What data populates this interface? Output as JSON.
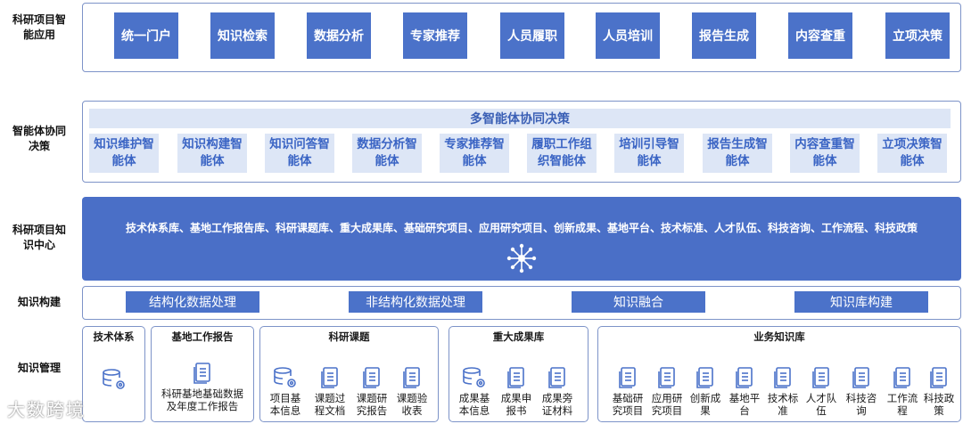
{
  "row_labels": {
    "apps": [
      "科研项目智",
      "能应用"
    ],
    "agents": [
      "智能体协同",
      "决策"
    ],
    "center": [
      "科研项目知",
      "识中心"
    ],
    "build": "知识构建",
    "manage": "知识管理"
  },
  "apps": [
    "统一门户",
    "知识检索",
    "数据分析",
    "专家推荐",
    "人员履职",
    "人员培训",
    "报告生成",
    "内容查重",
    "立项决策"
  ],
  "agents_title": "多智能体协同决策",
  "agents": [
    [
      "知识维护智",
      "能体"
    ],
    [
      "知识构建智",
      "能体"
    ],
    [
      "知识问答智",
      "能体"
    ],
    [
      "数据分析智",
      "能体"
    ],
    [
      "专家推荐智",
      "能体"
    ],
    [
      "履职工作组",
      "织智能体"
    ],
    [
      "培训引导智",
      "能体"
    ],
    [
      "报告生成智",
      "能体"
    ],
    [
      "内容查重智",
      "能体"
    ],
    [
      "立项决策智",
      "能体"
    ]
  ],
  "center_text": "技术体系库、基地工作报告库、科研课题库、重大成果库、基础研究项目、应用研究项目、创新成果、基地平台、技术标准、人才队伍、科技咨询、工作流程、科技政策",
  "hub_icon": "network-hub-icon",
  "build_steps": [
    "结构化数据处理",
    "非结构化数据处理",
    "知识融合",
    "知识库构建"
  ],
  "groups": {
    "tech": {
      "title": "技术体系"
    },
    "base": {
      "title": "基地工作报告",
      "item": [
        "科研基地基础数据",
        "及年度工作报告"
      ]
    },
    "keyan": {
      "title": "科研课题",
      "items": [
        [
          "项目基",
          "本信息"
        ],
        [
          "课题过",
          "程文档"
        ],
        [
          "课题研",
          "究报告"
        ],
        [
          "课题验",
          "收表"
        ]
      ]
    },
    "zhongda": {
      "title": "重大成果库",
      "items": [
        [
          "成果基",
          "本信息"
        ],
        [
          "成果申",
          "报书"
        ],
        [
          "成果旁",
          "证材料"
        ]
      ]
    },
    "yewu": {
      "title": "业务知识库",
      "items": [
        [
          "基础研",
          "究项目"
        ],
        [
          "应用研",
          "究项目"
        ],
        [
          "创新成",
          "果"
        ],
        [
          "基地平",
          "台"
        ],
        [
          "技术标",
          "准"
        ],
        [
          "人才队",
          "伍"
        ],
        [
          "科技咨",
          "询"
        ],
        [
          "工作流",
          "程"
        ],
        [
          "科技政",
          "策"
        ]
      ]
    }
  },
  "watermark": "大数跨境",
  "colors": {
    "primary": "#4b72c9",
    "light": "#dde6f6",
    "border": "#7d93c8"
  }
}
